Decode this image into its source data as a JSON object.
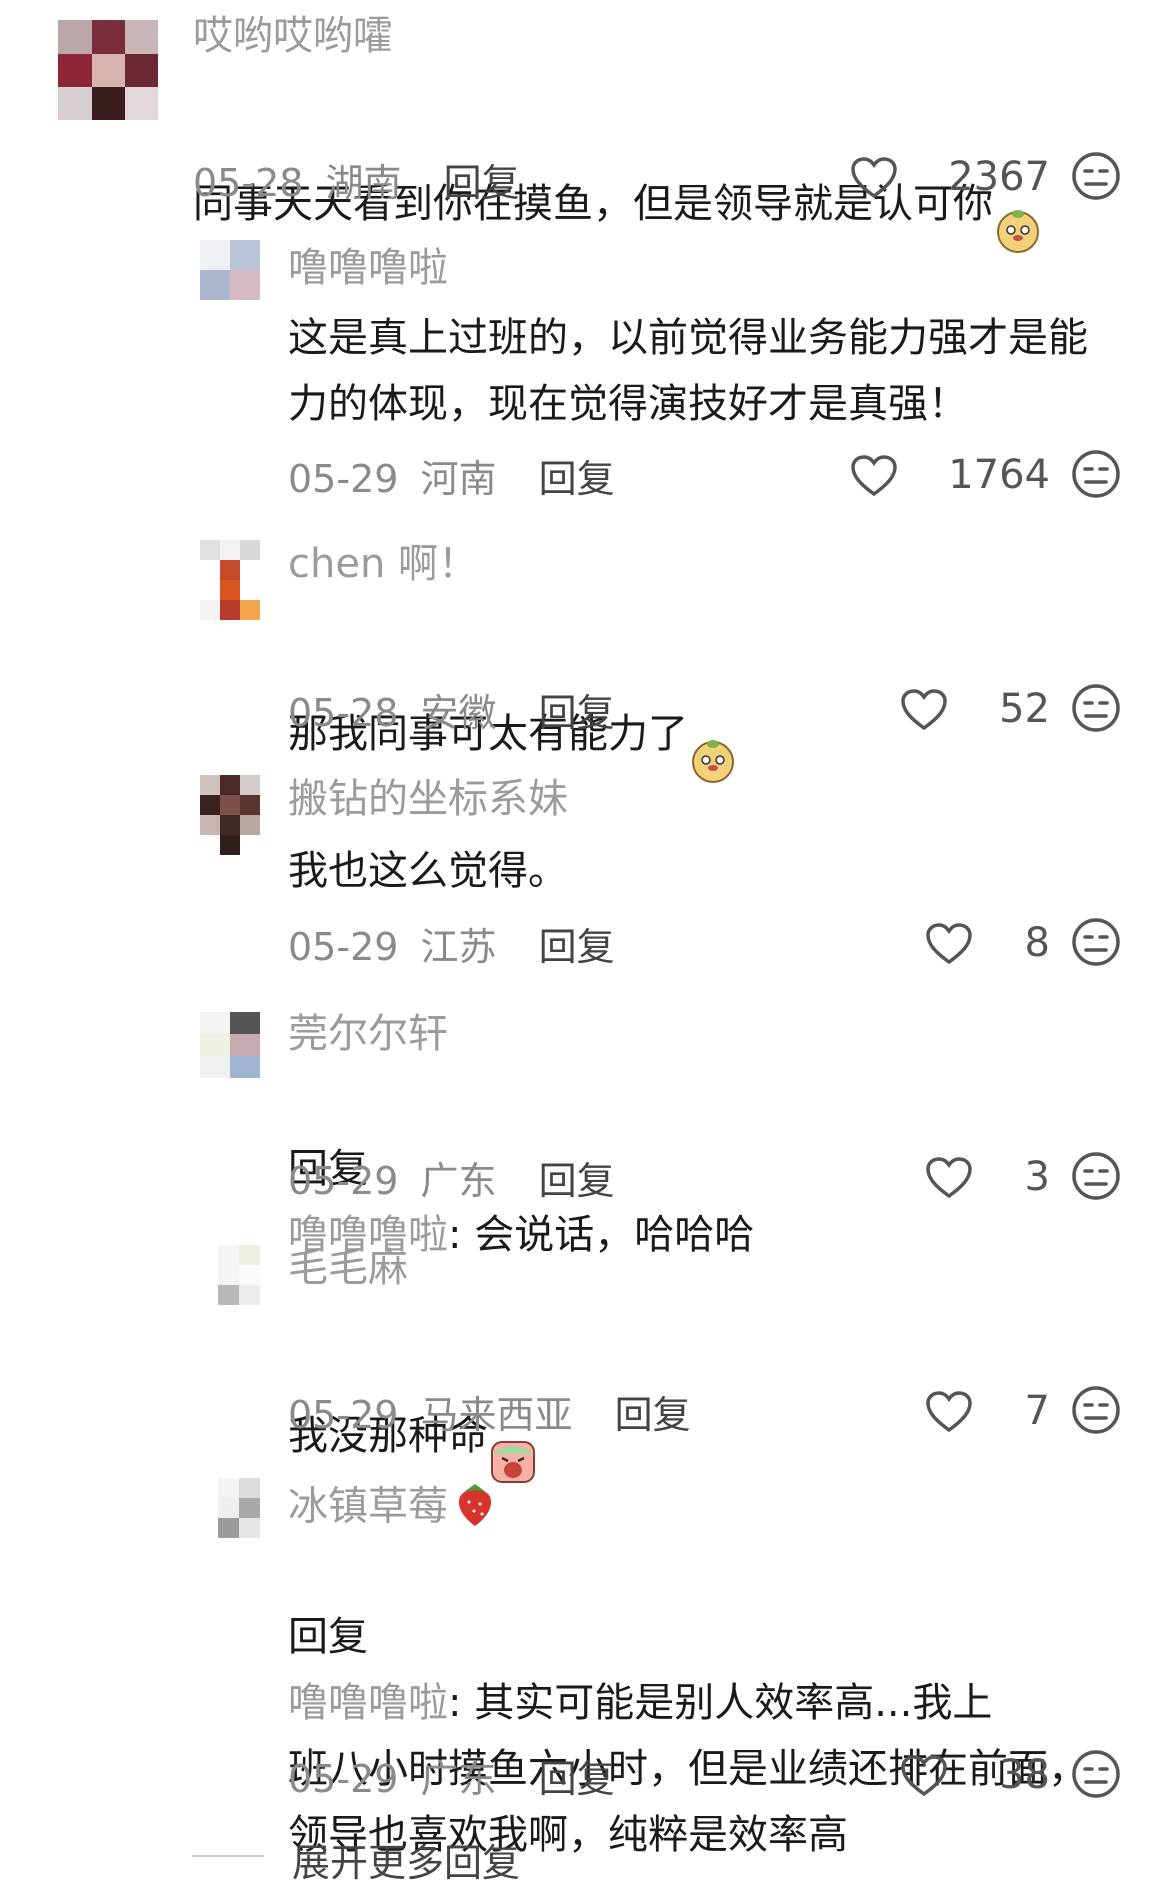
{
  "comments": [
    {
      "user": "哎哟哎哟嚯",
      "text": "同事天天看到你在摸鱼，但是领导就是认可你",
      "date": "05-28",
      "location": "湖南",
      "reply": "回复",
      "likes": "2367",
      "emoji": "dog-face-emoji"
    },
    {
      "user": "噜噜噜啦",
      "text": "这是真上过班的，以前觉得业务能力强才是能\n力的体现，现在觉得演技好才是真强！",
      "date": "05-29",
      "location": "河南",
      "reply": "回复",
      "likes": "1764"
    },
    {
      "user": "chen 啊！",
      "text": "那我同事可太有能力了",
      "date": "05-28",
      "location": "安徽",
      "reply": "回复",
      "likes": "52",
      "emoji": "dog-face-emoji"
    },
    {
      "user": "搬钻的坐标系妹",
      "text": "我也这么觉得。",
      "date": "05-29",
      "location": "江苏",
      "reply": "回复",
      "likes": "8"
    },
    {
      "user": "莞尔尔轩",
      "reply_prefix": "回复",
      "reply_target": "噜噜噜啦",
      "text": ": 会说话，哈哈哈",
      "date": "05-29",
      "location": "广东",
      "reply": "回复",
      "likes": "3"
    },
    {
      "user": "毛毛麻",
      "text": "我没那种命",
      "date": "05-29",
      "location": "马来西亚",
      "reply": "回复",
      "likes": "7",
      "emoji": "crying-face-emoji"
    },
    {
      "user": "冰镇草莓",
      "user_emoji": "strawberry-emoji",
      "reply_prefix": "回复",
      "reply_target": "噜噜噜啦",
      "text": ": 其实可能是别人效率高...我上\n班八小时摸鱼六小时，但是业绩还排在前面，\n领导也喜欢我啊，纯粹是效率高",
      "date": "05-29",
      "location": "广东",
      "reply": "回复",
      "likes": "38"
    }
  ],
  "expand_label": "展开更多回复",
  "colors": {
    "username": "#9b9b9b",
    "text": "#1a1a1a",
    "meta": "#8a8a8a",
    "icon": "#555555"
  }
}
